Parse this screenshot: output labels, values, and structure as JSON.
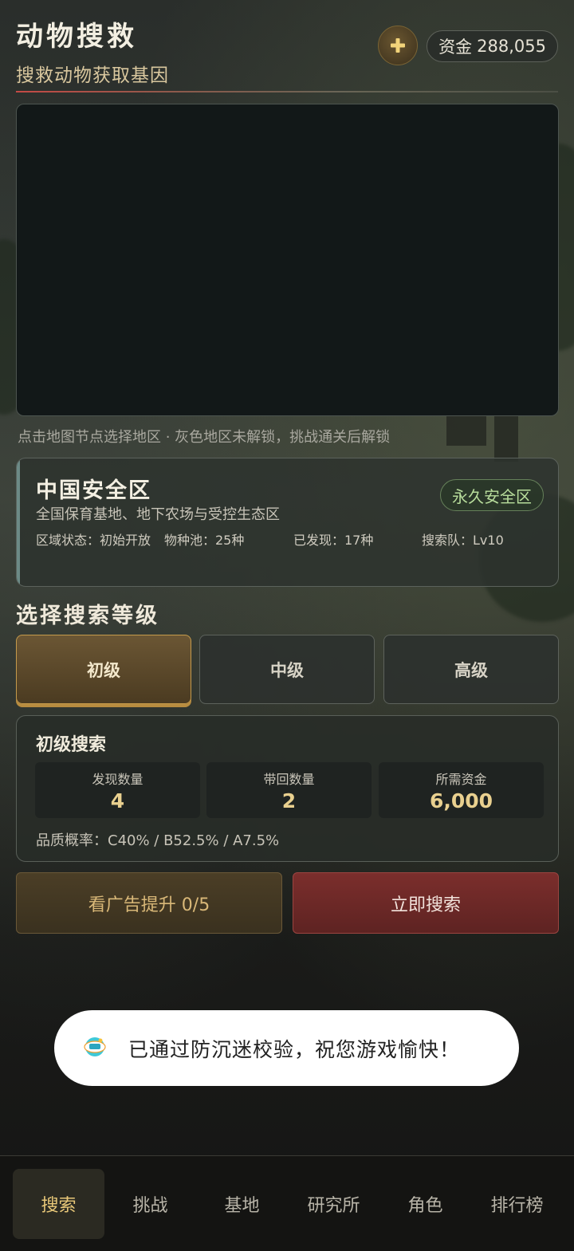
{
  "header": {
    "title": "动物搜救",
    "subtitle": "搜救动物获取基因",
    "add_icon": "plus-icon",
    "funds_label": "资金",
    "funds_value": "288,055"
  },
  "map": {
    "hint": "点击地图节点选择地区 · 灰色地区未解锁，挑战通关后解锁"
  },
  "region": {
    "name": "中国安全区",
    "description": "全国保育基地、地下农场与受控生态区",
    "badge": "永久安全区",
    "stats": [
      {
        "label": "区域状态：初始开放"
      },
      {
        "label": "物种池：25种"
      },
      {
        "label": "已发现：17种"
      },
      {
        "label": "搜索队：Lv10"
      }
    ]
  },
  "level_select": {
    "title": "选择搜索等级",
    "levels": [
      {
        "label": "初级",
        "active": true
      },
      {
        "label": "中级",
        "active": false
      },
      {
        "label": "高级",
        "active": false
      }
    ]
  },
  "search_detail": {
    "title": "初级搜索",
    "metrics": [
      {
        "label": "发现数量",
        "value": "4"
      },
      {
        "label": "带回数量",
        "value": "2"
      },
      {
        "label": "所需资金",
        "value": "6,000"
      }
    ],
    "quality": "品质概率：C40% / B52.5% / A7.5%"
  },
  "actions": {
    "ad_label": "看广告提升 0/5",
    "search_label": "立即搜索"
  },
  "toast": {
    "icon": "taptap-logo-icon",
    "text": "已通过防沉迷校验，祝您游戏愉快！"
  },
  "tabs": [
    {
      "label": "搜索",
      "active": true
    },
    {
      "label": "挑战",
      "active": false
    },
    {
      "label": "基地",
      "active": false
    },
    {
      "label": "研究所",
      "active": false
    },
    {
      "label": "角色",
      "active": false
    },
    {
      "label": "排行榜",
      "active": false
    }
  ],
  "colors": {
    "accent_gold": "#e9c879",
    "danger_red": "#7b2e2c",
    "safe_green": "#b8dd9c"
  }
}
